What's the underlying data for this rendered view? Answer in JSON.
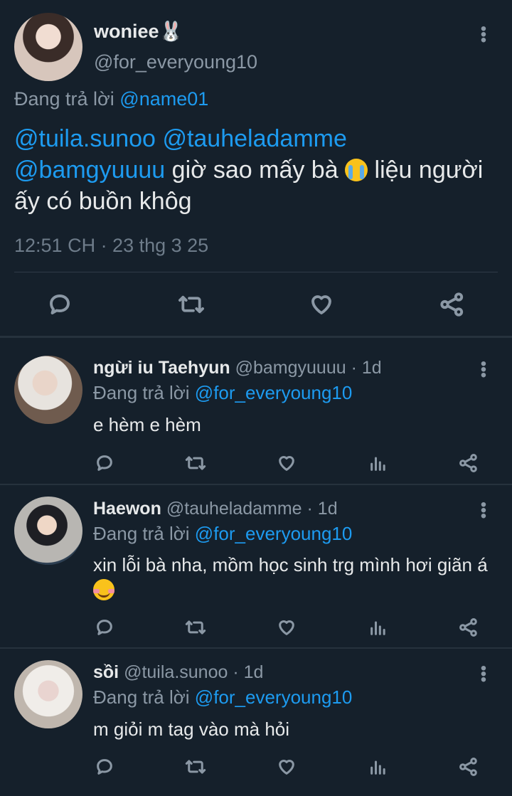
{
  "main_tweet": {
    "display_name": "woniee🐰",
    "handle": "@for_everyoung10",
    "reply_prefix": "Đang trả lời",
    "reply_to": "@name01",
    "mentions": [
      "@tuila.sunoo",
      "@tauheladamme",
      "@bamgyuuuu"
    ],
    "text_part1": "giờ sao mấy bà",
    "emoji": "loudly-crying-face",
    "text_part2": "liệu người ấy có buồn khôg",
    "timestamp": "12:51 CH · 23 thg 3 25",
    "actions": [
      "reply-icon",
      "retweet-icon",
      "like-icon",
      "share-icon"
    ]
  },
  "replies": [
    {
      "display_name": "ngừi iu Taehyun",
      "handle": "@bamgyuuuu",
      "age": "· 1d",
      "reply_prefix": "Đang trả lời",
      "reply_to": "@for_everyoung10",
      "text": "e hèm e hèm"
    },
    {
      "display_name": "Haewon",
      "handle": "@tauheladamme",
      "age": "· 1d",
      "reply_prefix": "Đang trả lời",
      "reply_to": "@for_everyoung10",
      "text": "xin lỗi bà nha, mồm học sinh trg mình hơi giãn á",
      "emoji": "smiling-face"
    },
    {
      "display_name": "sồi",
      "handle": "@tuila.sunoo",
      "age": "· 1d",
      "reply_prefix": "Đang trả lời",
      "reply_to": "@for_everyoung10",
      "text": "m giỏi m tag vào mà hỏi"
    }
  ],
  "colors": {
    "background": "#15202b",
    "accent": "#1d9bf0",
    "muted": "#8b98a5"
  }
}
